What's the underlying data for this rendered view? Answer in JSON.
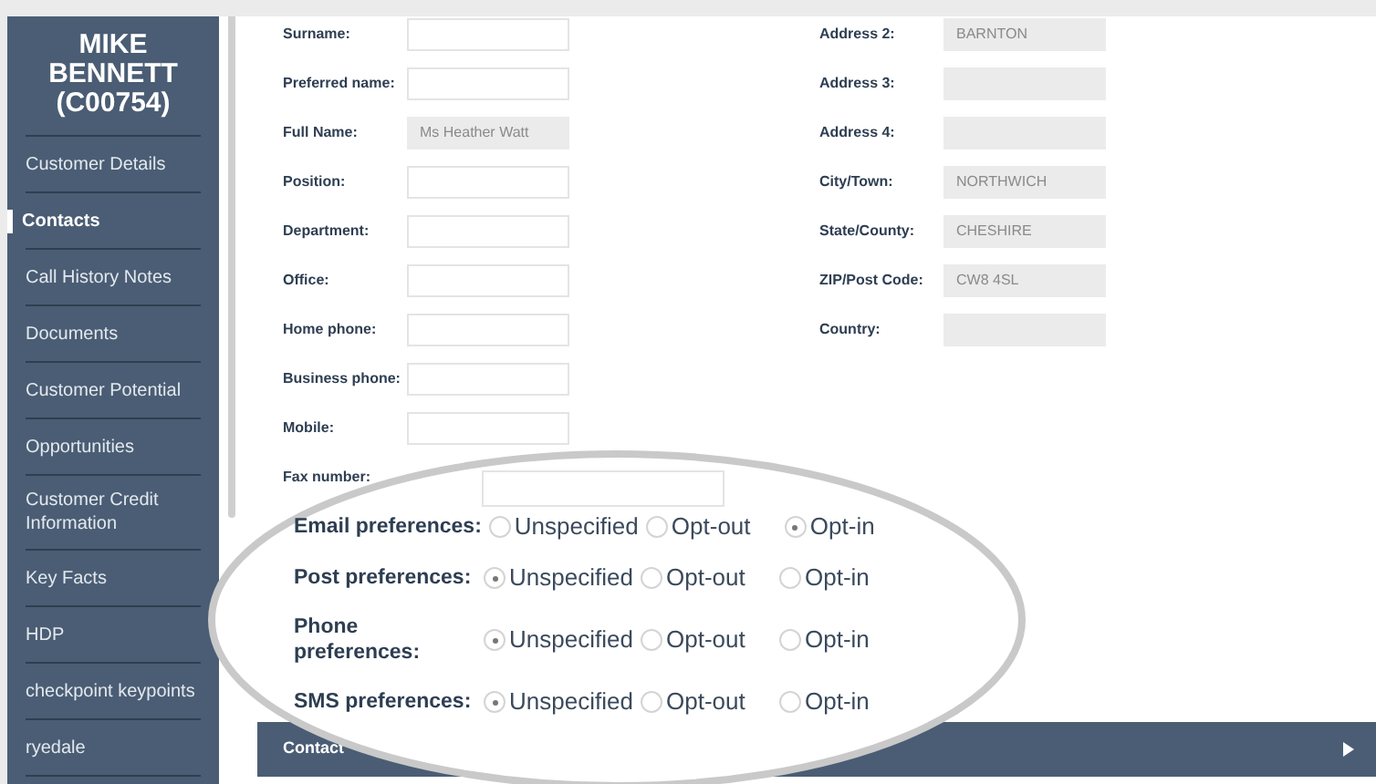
{
  "sidebar": {
    "title": "MIKE BENNETT (C00754)",
    "items": [
      {
        "label": "Customer Details",
        "selected": false
      },
      {
        "label": "Contacts",
        "selected": true
      },
      {
        "label": "Call History Notes",
        "selected": false
      },
      {
        "label": "Documents",
        "selected": false
      },
      {
        "label": "Customer Potential",
        "selected": false
      },
      {
        "label": "Opportunities",
        "selected": false
      },
      {
        "label": "Customer Credit Information",
        "selected": false
      },
      {
        "label": "Key Facts",
        "selected": false
      },
      {
        "label": "HDP",
        "selected": false
      },
      {
        "label": "checkpoint keypoints",
        "selected": false
      },
      {
        "label": "ryedale",
        "selected": false
      }
    ]
  },
  "form": {
    "left_fields": [
      {
        "label": "Surname:",
        "disabled": false
      },
      {
        "label": "Preferred name:",
        "disabled": false
      },
      {
        "label": "Full Name:",
        "value": "Ms Heather Watt",
        "disabled": true
      },
      {
        "label": "Position:",
        "disabled": false
      },
      {
        "label": "Department:",
        "disabled": false
      },
      {
        "label": "Office:",
        "disabled": false
      },
      {
        "label": "Home phone:",
        "disabled": false
      },
      {
        "label": "Business phone:",
        "disabled": false
      },
      {
        "label": "Mobile:",
        "disabled": false
      },
      {
        "label": "Fax number:",
        "disabled": false
      }
    ],
    "right_fields": [
      {
        "label": "Address 2:",
        "value": "BARNTON",
        "disabled": true
      },
      {
        "label": "Address 3:",
        "disabled": true
      },
      {
        "label": "Address 4:",
        "disabled": true
      },
      {
        "label": "City/Town:",
        "value": "NORTHWICH",
        "disabled": true
      },
      {
        "label": "State/County:",
        "value": "CHESHIRE",
        "disabled": true
      },
      {
        "label": "ZIP/Post Code:",
        "value": "CW8 4SL",
        "disabled": true
      },
      {
        "label": "Country:",
        "disabled": true
      }
    ]
  },
  "preferences": [
    {
      "label": "Email preferences:",
      "options": [
        {
          "label": "Unspecified",
          "selected": false
        },
        {
          "label": "Opt-out",
          "selected": false
        },
        {
          "label": "Opt-in",
          "selected": true
        }
      ]
    },
    {
      "label": "Post preferences:",
      "options": [
        {
          "label": "Unspecified",
          "selected": true
        },
        {
          "label": "Opt-out",
          "selected": false
        },
        {
          "label": "Opt-in",
          "selected": false
        }
      ]
    },
    {
      "label": "Phone preferences:",
      "options": [
        {
          "label": "Unspecified",
          "selected": true
        },
        {
          "label": "Opt-out",
          "selected": false
        },
        {
          "label": "Opt-in",
          "selected": false
        }
      ]
    },
    {
      "label": "SMS preferences:",
      "options": [
        {
          "label": "Unspecified",
          "selected": true
        },
        {
          "label": "Opt-out",
          "selected": false
        },
        {
          "label": "Opt-in",
          "selected": false
        }
      ]
    }
  ],
  "section_bar": {
    "title": "Contact"
  }
}
